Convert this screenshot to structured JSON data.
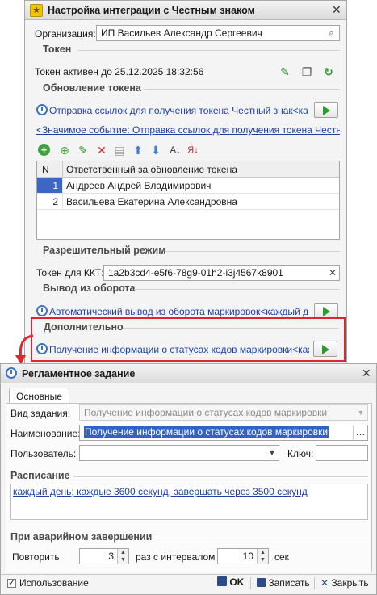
{
  "integration_window": {
    "title": "Настройка интеграции с Честным знаком",
    "organization_label": "Организация:",
    "organization_value": "ИП Васильев Александр Сергеевич",
    "token_section": "Токен",
    "token_status": "Токен активен до 25.12.2025 18:32:56",
    "token_update_section": "Обновление токена",
    "token_job_link": "Отправка ссылок для получения токена Честный знак<кажд...",
    "significant_event_link": "<Значимое событие: Отправка ссылок для получения токена Честный ...",
    "table": {
      "columns": [
        "N",
        "Ответственный за обновление токена"
      ],
      "rows": [
        {
          "n": "1",
          "name": "Андреев Андрей Владимирович"
        },
        {
          "n": "2",
          "name": "Васильева Екатерина Александровна"
        }
      ]
    },
    "permit_section": "Разрешительный режим",
    "kkt_token_label": "Токен для ККТ:",
    "kkt_token_value": "1a2b3cd4-e5f6-78g9-01h2-i3j4567k8901",
    "withdrawal_section": "Вывод из оборота",
    "withdrawal_job_link": "Автоматический вывод из оборота маркировок<каждый день...",
    "extra_section": "Дополнительно",
    "extra_job_link": "Получение информации о статусах кодов маркировки<кажды..."
  },
  "job_window": {
    "title": "Регламентное задание",
    "tab_main": "Основные",
    "job_type_label": "Вид задания:",
    "job_type_value": "Получение информации о статусах кодов маркировки",
    "name_label": "Наименование:",
    "name_value": "Получение информации о статусах кодов маркировки",
    "user_label": "Пользователь:",
    "user_value": "",
    "key_label": "Ключ:",
    "key_value": "",
    "schedule_section": "Расписание",
    "schedule_link": "каждый день; каждые 3600 секунд, завершать через 3500 секунд",
    "on_failure_section": "При аварийном завершении",
    "retry_label": "Повторить",
    "retry_value": "3",
    "interval_label": "раз с интервалом",
    "interval_value": "10",
    "sec_label": "сек",
    "use_label": "Использование",
    "use_checked": true,
    "ok_label": "OK",
    "save_label": "Записать",
    "close_label": "Закрыть"
  },
  "colors": {
    "link": "#1f3fa6",
    "highlight_frame": "#e0262a",
    "section_line": "#d2d2d2",
    "play_icon": "#2e9a2e"
  }
}
